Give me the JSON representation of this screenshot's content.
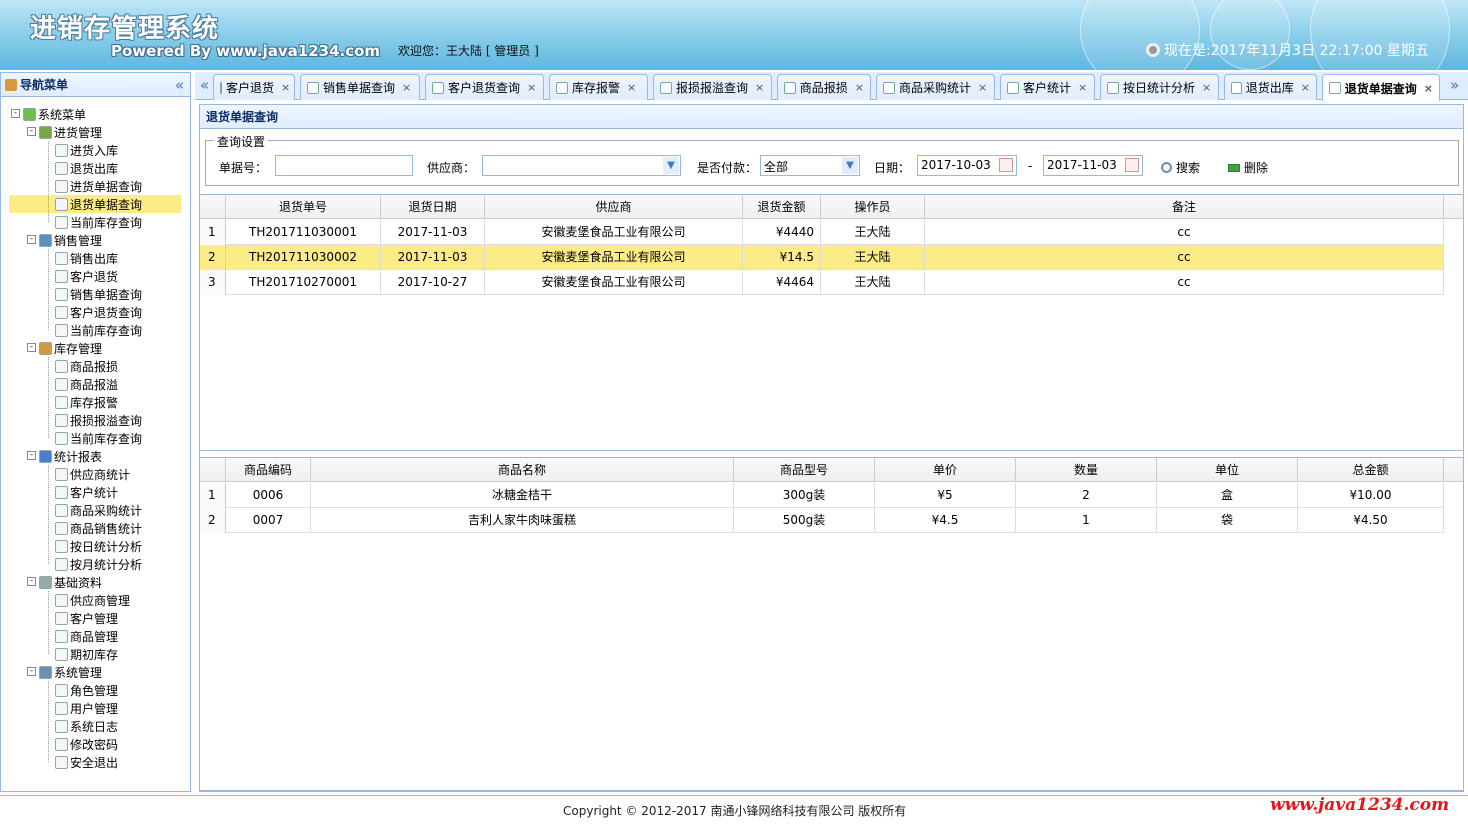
{
  "header": {
    "title": "进销存管理系统",
    "powered": "Powered By www.java1234.com",
    "welcome": "欢迎您：王大陆 [ 管理员 ]",
    "clock": "现在是:2017年11月3日 22:17:00 星期五"
  },
  "nav": {
    "title": "导航菜单",
    "collapse": "«",
    "root": "系统菜单",
    "groups": [
      {
        "label": "进货管理",
        "items": [
          "进货入库",
          "退货出库",
          "进货单据查询",
          "退货单据查询",
          "当前库存查询"
        ]
      },
      {
        "label": "销售管理",
        "items": [
          "销售出库",
          "客户退货",
          "销售单据查询",
          "客户退货查询",
          "当前库存查询"
        ]
      },
      {
        "label": "库存管理",
        "items": [
          "商品报损",
          "商品报溢",
          "库存报警",
          "报损报溢查询",
          "当前库存查询"
        ]
      },
      {
        "label": "统计报表",
        "items": [
          "供应商统计",
          "客户统计",
          "商品采购统计",
          "商品销售统计",
          "按日统计分析",
          "按月统计分析"
        ]
      },
      {
        "label": "基础资料",
        "items": [
          "供应商管理",
          "客户管理",
          "商品管理",
          "期初库存"
        ]
      },
      {
        "label": "系统管理",
        "items": [
          "角色管理",
          "用户管理",
          "系统日志",
          "修改密码",
          "安全退出"
        ]
      }
    ],
    "selected": "退货单据查询"
  },
  "tabs": {
    "left_scroll": "«",
    "right_scroll": "»",
    "close": "×",
    "items": [
      "客户退货",
      "销售单据查询",
      "客户退货查询",
      "库存报警",
      "报损报溢查询",
      "商品报损",
      "商品采购统计",
      "客户统计",
      "按日统计分析",
      "退货出库",
      "退货单据查询"
    ],
    "active": "退货单据查询"
  },
  "panel": {
    "title": "退货单据查询"
  },
  "query": {
    "legend": "查询设置",
    "order_no_label": "单据号：",
    "order_no_value": "",
    "supplier_label": "供应商：",
    "supplier_value": "",
    "paid_label": "是否付款：",
    "paid_value": "全部",
    "date_label": "日期：",
    "date_from": "2017-10-03",
    "date_sep": "-",
    "date_to": "2017-11-03",
    "search_label": "搜索",
    "delete_label": "删除"
  },
  "orders": {
    "columns": [
      "退货单号",
      "退货日期",
      "供应商",
      "退货金额",
      "操作员",
      "备注"
    ],
    "rows": [
      {
        "num": "1",
        "no": "TH201711030001",
        "date": "2017-11-03",
        "supplier": "安徽麦堡食品工业有限公司",
        "amount": "¥4440",
        "operator": "王大陆",
        "remark": "cc"
      },
      {
        "num": "2",
        "no": "TH201711030002",
        "date": "2017-11-03",
        "supplier": "安徽麦堡食品工业有限公司",
        "amount": "¥14.5",
        "operator": "王大陆",
        "remark": "cc"
      },
      {
        "num": "3",
        "no": "TH201710270001",
        "date": "2017-10-27",
        "supplier": "安徽麦堡食品工业有限公司",
        "amount": "¥4464",
        "operator": "王大陆",
        "remark": "cc"
      }
    ],
    "selected_row": 2
  },
  "items": {
    "columns": [
      "商品编码",
      "商品名称",
      "商品型号",
      "单价",
      "数量",
      "单位",
      "总金额"
    ],
    "rows": [
      {
        "num": "1",
        "code": "0006",
        "name": "冰糖金桔干",
        "model": "300g装",
        "price": "¥5",
        "qty": "2",
        "unit": "盒",
        "total": "¥10.00"
      },
      {
        "num": "2",
        "code": "0007",
        "name": "吉利人家牛肉味蛋糕",
        "model": "500g装",
        "price": "¥4.5",
        "qty": "1",
        "unit": "袋",
        "total": "¥4.50"
      }
    ]
  },
  "footer": {
    "copyright": "Copyright © 2012-2017 南通小锋网络科技有限公司 版权所有",
    "watermark": "www.java1234.com"
  }
}
